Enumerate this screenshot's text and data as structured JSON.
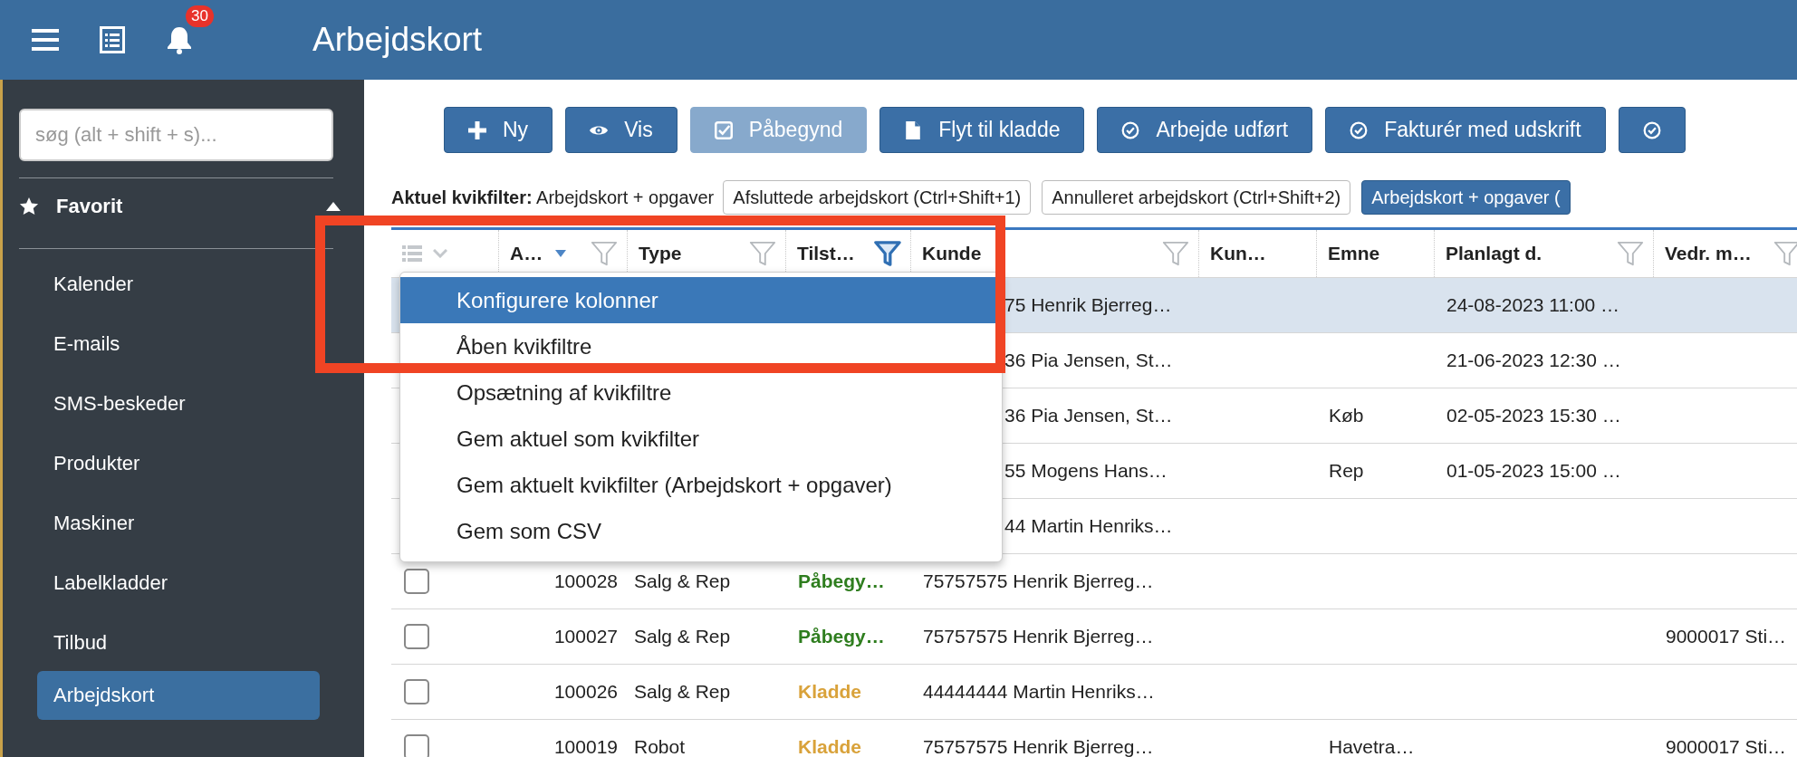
{
  "topbar": {
    "notifications": "30",
    "title": "Arbejdskort"
  },
  "sidebar": {
    "search": {
      "placeholder": "søg (alt + shift + s)..."
    },
    "section": {
      "label": "Favorit",
      "expanded": true
    },
    "items": [
      {
        "label": "Kalender",
        "selected": false
      },
      {
        "label": "E-mails",
        "selected": false
      },
      {
        "label": "SMS-beskeder",
        "selected": false
      },
      {
        "label": "Produkter",
        "selected": false
      },
      {
        "label": "Maskiner",
        "selected": false
      },
      {
        "label": "Labelkladder",
        "selected": false
      },
      {
        "label": "Tilbud",
        "selected": false
      },
      {
        "label": "Arbejdskort",
        "selected": true
      }
    ]
  },
  "toolbar": [
    {
      "kind": "plus",
      "label": "Ny",
      "disabled": false
    },
    {
      "kind": "eye",
      "label": "Vis",
      "disabled": false
    },
    {
      "kind": "check-square",
      "label": "Påbegynd",
      "disabled": true
    },
    {
      "kind": "file",
      "label": "Flyt til kladde",
      "disabled": false
    },
    {
      "kind": "check-circle",
      "label": "Arbejde udført",
      "disabled": false
    },
    {
      "kind": "check-circle",
      "label": "Fakturér med udskrift",
      "disabled": false
    },
    {
      "kind": "check-circle",
      "disabled": false
    }
  ],
  "quickfilter": {
    "label": "Aktuel kvikfilter:",
    "value": "Arbejdskort + opgaver",
    "chips": [
      {
        "label": "Afsluttede arbejdskort (Ctrl+Shift+1)",
        "selected": false
      },
      {
        "label": "Annulleret arbejdskort (Ctrl+Shift+2)",
        "selected": false
      },
      {
        "label": "Arbejdskort + opgaver (",
        "selected": true
      }
    ]
  },
  "table": {
    "columns": [
      {
        "label": "A…",
        "sorted": true,
        "filterable": true,
        "filter_active": false
      },
      {
        "label": "Type",
        "filterable": true,
        "filter_active": false
      },
      {
        "label": "Tilst…",
        "filterable": true,
        "filter_active": true
      },
      {
        "label": "Kunde",
        "filterable": true,
        "filter_active": false
      },
      {
        "label": "Kun…",
        "filterable": false,
        "filter_active": false
      },
      {
        "label": "Emne",
        "filterable": false,
        "filter_active": false
      },
      {
        "label": "Planlagt d.",
        "filterable": true,
        "filter_active": false
      },
      {
        "label": "Vedr. m…",
        "filterable": true,
        "filter_active": false
      }
    ],
    "rows": [
      {
        "selected": true,
        "kunde": "75 Henrik Bjerreg…",
        "planlagt": "24-08-2023 11:00 …"
      },
      {
        "selected": false,
        "kunde": "36 Pia Jensen, St…",
        "planlagt": "21-06-2023 12:30 …"
      },
      {
        "selected": false,
        "kunde": "36 Pia Jensen, St…",
        "emne": "Køb",
        "planlagt": "02-05-2023 15:30 …"
      },
      {
        "selected": false,
        "kunde": "55 Mogens Hans…",
        "emne": "Rep",
        "planlagt": "01-05-2023 15:00 …"
      },
      {
        "selected": false,
        "kunde": "44 Martin Henriks…"
      },
      {
        "selected": false,
        "checked": false,
        "nr": "100028",
        "type": "Salg & Rep",
        "status": {
          "text": "Påbegy…",
          "color": "#2e7d1e"
        },
        "kunde": "75757575 Henrik Bjerreg…"
      },
      {
        "selected": false,
        "checked": false,
        "nr": "100027",
        "type": "Salg & Rep",
        "status": {
          "text": "Påbegy…",
          "color": "#2e7d1e"
        },
        "kunde": "75757575 Henrik Bjerreg…",
        "vedr": "9000017 Sti…"
      },
      {
        "selected": false,
        "checked": false,
        "nr": "100026",
        "type": "Salg & Rep",
        "status": {
          "text": "Kladde",
          "color": "#d9a23a"
        },
        "kunde": "44444444 Martin Henriks…"
      },
      {
        "selected": false,
        "checked": false,
        "nr": "100019",
        "type": "Robot",
        "status": {
          "text": "Kladde",
          "color": "#d9a23a"
        },
        "kunde": "75757575 Henrik Bjerreg…",
        "emne": "Havetra…",
        "vedr": "9000017 Sti…"
      }
    ]
  },
  "column_menu": [
    {
      "label": "Konfigurere kolonner",
      "selected": true
    },
    {
      "label": "Åben kvikfiltre",
      "selected": false
    },
    {
      "label": "Opsætning af kvikfiltre",
      "selected": false
    },
    {
      "label": "Gem aktuel som kvikfilter",
      "selected": false
    },
    {
      "label": "Gem aktuelt kvikfilter (Arbejdskort + opgaver)",
      "selected": false
    },
    {
      "label": "Gem som CSV",
      "selected": false
    }
  ]
}
